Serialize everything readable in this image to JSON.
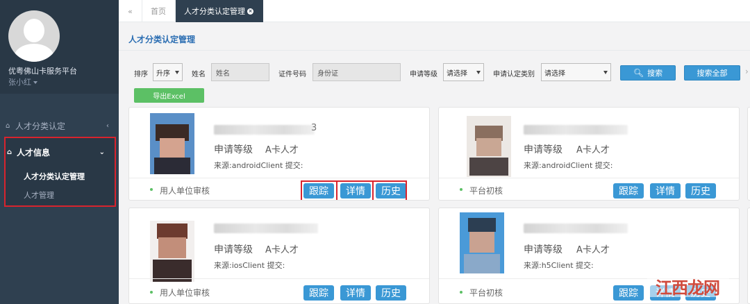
{
  "sidebar": {
    "platform_name": "优粤佛山卡服务平台",
    "user_name": "张小红",
    "menu": [
      {
        "label": "人才分类认定",
        "icon": "home-icon",
        "arrow": "‹"
      },
      {
        "label": "人才信息",
        "icon": "home-icon",
        "arrow": "⌄"
      }
    ],
    "submenu": [
      {
        "label": "人才分类认定管理",
        "active": true
      },
      {
        "label": "人才管理",
        "active": false
      }
    ]
  },
  "tabs": {
    "back_icon": "«",
    "items": [
      {
        "label": "首页",
        "active": false
      },
      {
        "label": "人才分类认定管理",
        "active": true,
        "close": "×"
      }
    ]
  },
  "page_title": "人才分类认定管理",
  "filters": {
    "sort_label": "排序",
    "sort_value": "升序",
    "name_label": "姓名",
    "name_placeholder": "姓名",
    "id_label": "证件号码",
    "id_placeholder": "身份证",
    "level_label": "申请等级",
    "level_value": "请选择",
    "type_label": "申请认定类别",
    "type_value": "请选择",
    "search_label": "搜索",
    "search_all_label": "搜索全部",
    "export_label": "导出Excel",
    "more_icon": "›"
  },
  "cards": [
    {
      "name_tail": "3",
      "level_label": "申请等级",
      "level_value": "A卡人才",
      "source": "来源:androidClient 提交:",
      "status": "用人单位审核",
      "actions": [
        "跟踪",
        "详情",
        "历史"
      ]
    },
    {
      "name_tail": "",
      "level_label": "申请等级",
      "level_value": "A卡人才",
      "source": "来源:androidClient 提交:",
      "status": "平台初核",
      "actions": [
        "跟踪",
        "详情",
        "历史"
      ]
    },
    {
      "name_tail": "",
      "level_label": "申请等级",
      "level_value": "A卡人才",
      "source": "来源:iosClient 提交:",
      "status": "用人单位审核",
      "actions": [
        "跟踪",
        "详情",
        "历史"
      ]
    },
    {
      "name_tail": "",
      "level_label": "申请等级",
      "level_value": "A卡人才",
      "source": "来源:h5Client 提交:",
      "status": "平台初核",
      "actions": [
        "跟踪",
        "详情",
        "历史"
      ]
    }
  ],
  "watermark": "江西龙网",
  "colors": {
    "sidebar_bg": "#2f4050",
    "accent_blue": "#3a98d5",
    "export_green": "#5cc065",
    "highlight_red": "#d9232d",
    "title_blue": "#2a6db2"
  }
}
